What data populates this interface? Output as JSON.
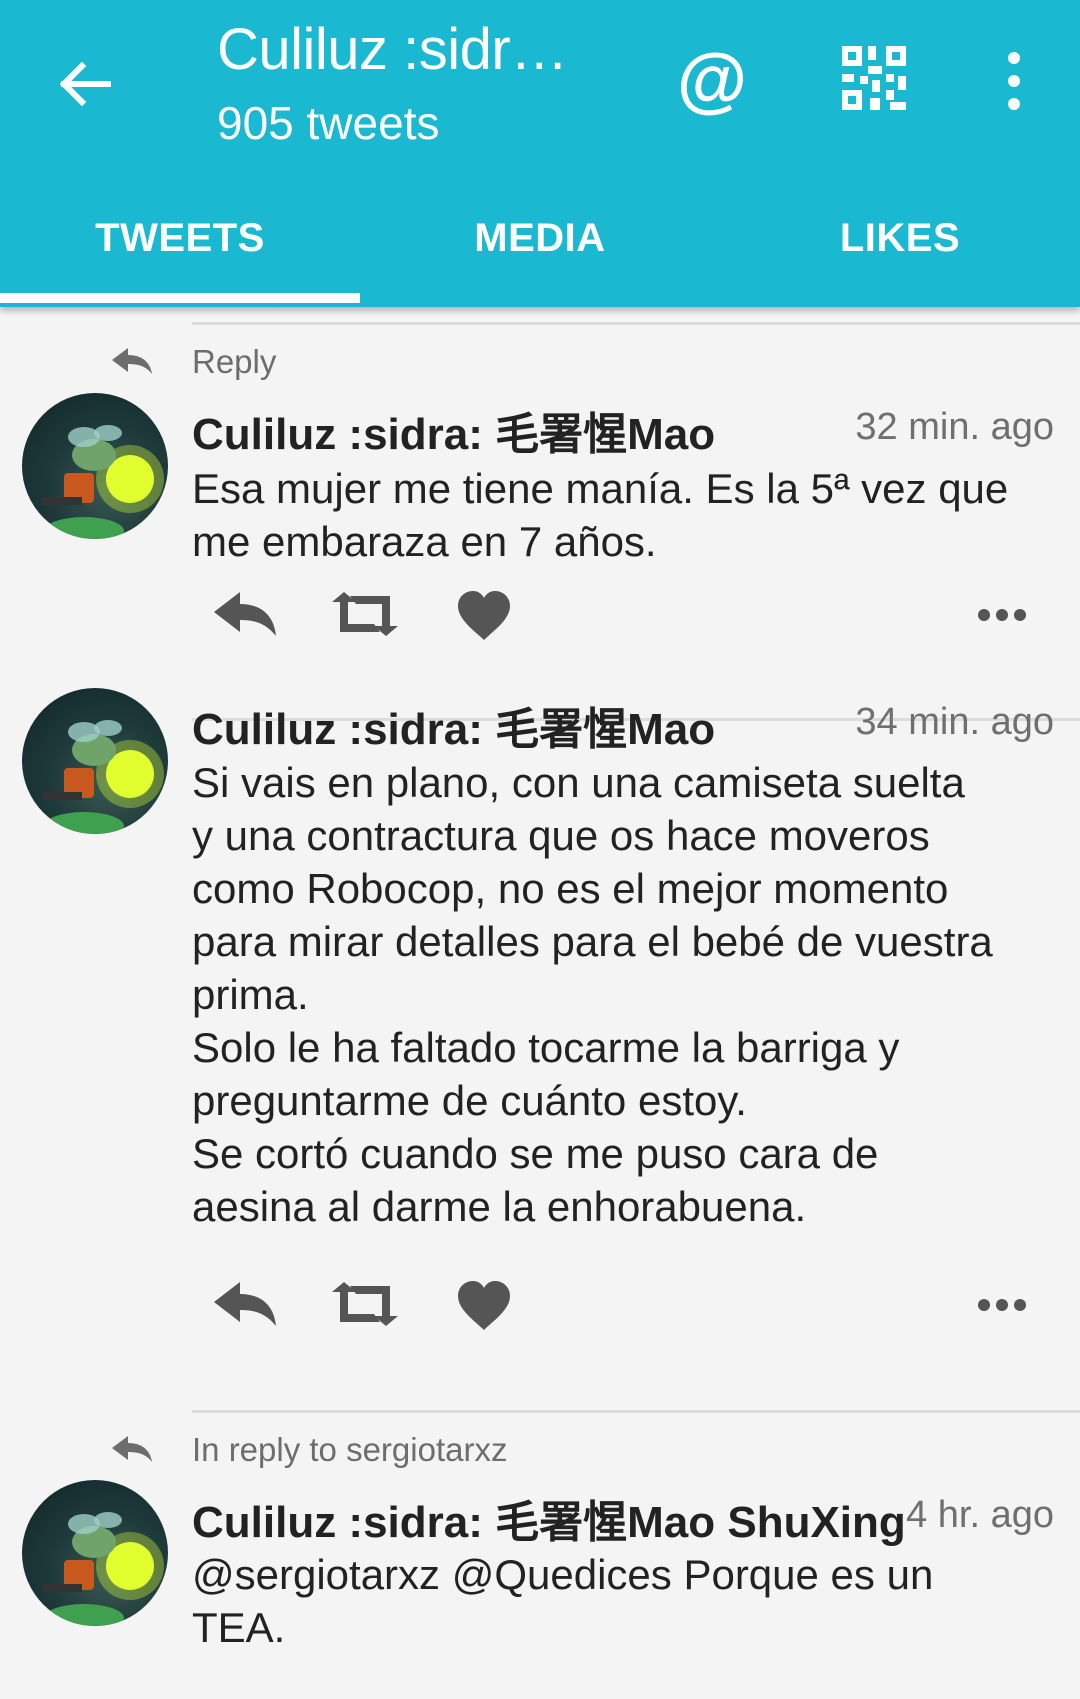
{
  "header": {
    "title": "Culiluz :sidr…",
    "subtitle": "905 tweets",
    "at_symbol": "@",
    "accent": "#1ab8d1"
  },
  "tabs": [
    {
      "label": "TWEETS",
      "active": true
    },
    {
      "label": "MEDIA",
      "active": false
    },
    {
      "label": "LIKES",
      "active": false
    }
  ],
  "tweets": [
    {
      "context": "Reply",
      "name": "Culiluz :sidra: 毛署惺Mao",
      "time": "32 min. ago",
      "text": "Esa mujer me tiene manía. Es la 5ª vez que\nme embaraza en 7 años."
    },
    {
      "context": "",
      "name": "Culiluz :sidra: 毛署惺Mao",
      "time": "34 min. ago",
      "text": "Si vais en plano, con una camiseta suelta\ny una contractura que os hace moveros\ncomo Robocop, no es el mejor momento\npara mirar detalles para el bebé de vuestra\nprima.\nSolo le ha faltado tocarme la barriga y\npreguntarme de cuánto estoy.\nSe cortó cuando se me puso cara de\naesina al darme la enhorabuena."
    },
    {
      "context": "In reply to sergiotarxz",
      "name": "Culiluz :sidra: 毛署惺Mao ShuXing",
      "time": "4 hr. ago",
      "text": "@sergiotarxz @Quedices Porque es un\nTEA."
    }
  ],
  "icons": [
    "back-arrow-icon",
    "at-icon",
    "qr-code-icon",
    "more-vert-icon",
    "reply-icon",
    "retweet-icon",
    "like-icon",
    "more-horiz-icon"
  ]
}
